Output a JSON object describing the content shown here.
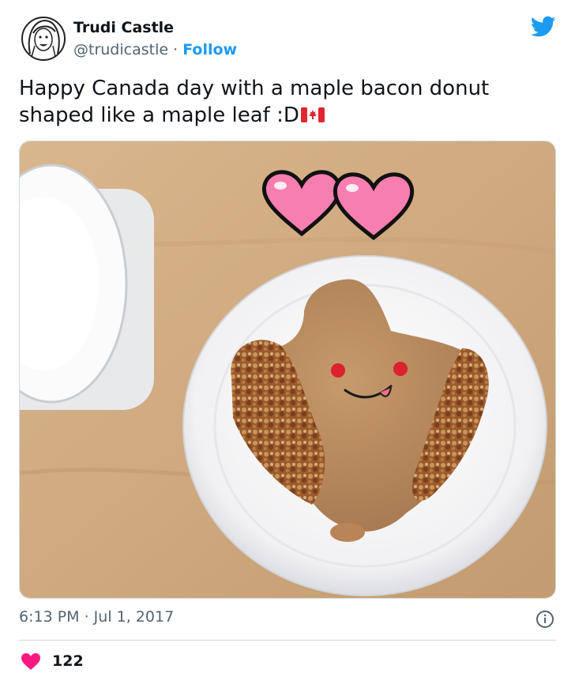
{
  "tweet": {
    "author_name": "Trudi Castle",
    "handle": "@trudicastle",
    "separator": " · ",
    "follow_label": "Follow",
    "text_line1": "Happy Canada day with a maple bacon donut",
    "text_line2": "shaped like a maple leaf :D",
    "timestamp": "6:13 PM · Jul 1, 2017",
    "likes": "122"
  },
  "icons": {
    "logo": "twitter-bird-icon",
    "flag": "canada-flag-icon",
    "info": "info-icon",
    "like": "heart-icon"
  },
  "colors": {
    "accent": "#1d9bf0",
    "like": "#f91880",
    "secondary_text": "#536471"
  }
}
